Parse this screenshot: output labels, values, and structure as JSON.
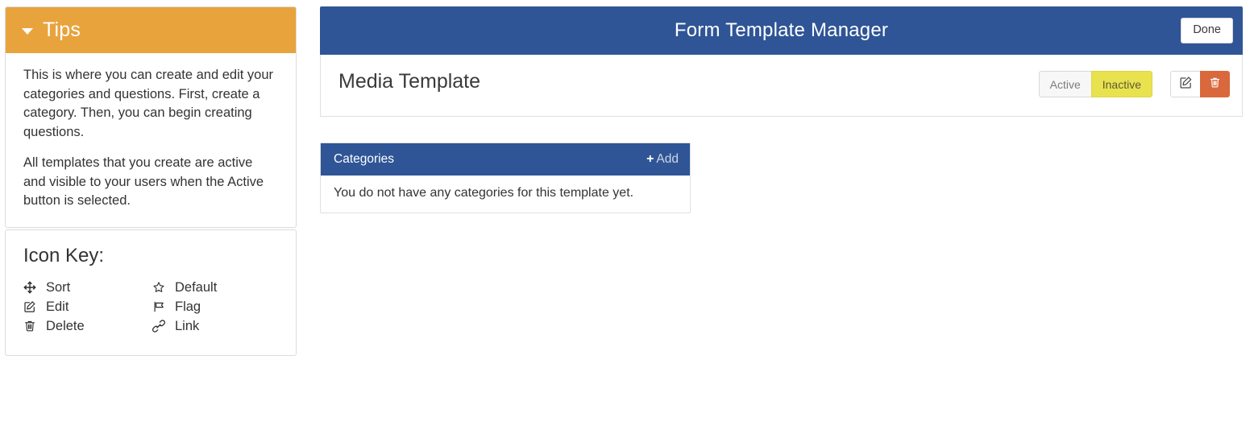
{
  "sidebar": {
    "tips": {
      "title": "Tips",
      "caret_icon": "caret-down-icon",
      "paragraphs": [
        "This is where you can create and edit your categories and questions. First, create a category. Then, you can begin creating questions.",
        "All templates that you create are active and visible to your users when the Active button is selected."
      ],
      "header_color": "#e8a33d"
    },
    "icon_key": {
      "title": "Icon Key:",
      "items": [
        {
          "icon": "arrows-move-icon",
          "label": "Sort"
        },
        {
          "icon": "pencil-square-icon",
          "label": "Edit"
        },
        {
          "icon": "trash-icon",
          "label": "Delete"
        },
        {
          "icon": "star-outline-icon",
          "label": "Default"
        },
        {
          "icon": "flag-icon",
          "label": "Flag"
        },
        {
          "icon": "link-chain-icon",
          "label": "Link"
        }
      ]
    }
  },
  "header": {
    "title": "Form Template Manager",
    "done_label": "Done",
    "background_color": "#2f5596"
  },
  "template": {
    "name": "Media Template",
    "state_buttons": [
      {
        "label": "Active",
        "selected": false
      },
      {
        "label": "Inactive",
        "selected": true
      }
    ],
    "active_label": "Active",
    "inactive_label": "Inactive",
    "inactive_color": "#e9e24f",
    "edit_icon": "pencil-square-icon",
    "delete_icon": "trash-icon",
    "delete_color": "#d9683c"
  },
  "categories": {
    "title": "Categories",
    "add_plus": "+",
    "add_label": "Add",
    "empty_message": "You do not have any categories for this template yet."
  }
}
